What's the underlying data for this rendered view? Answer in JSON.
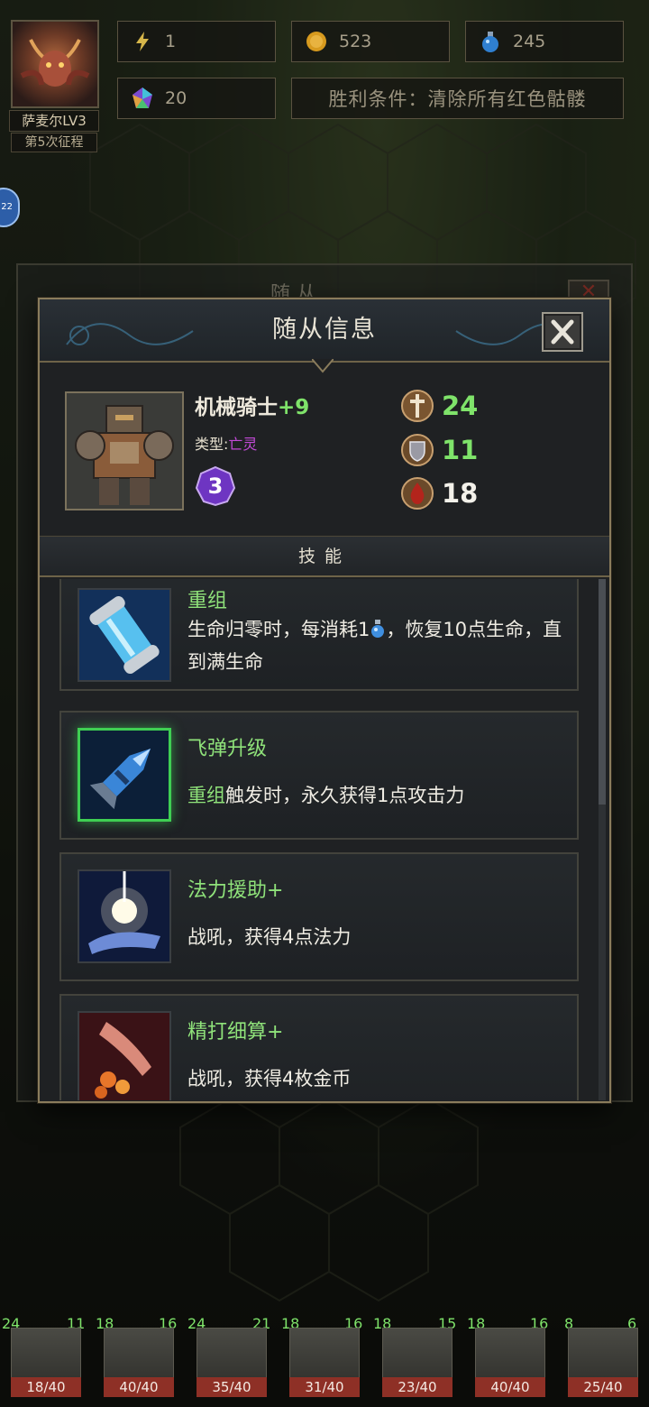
{
  "hud": {
    "hero_name": "萨麦尔LV3",
    "expedition": "第5次征程",
    "energy": "1",
    "gold": "523",
    "potion": "245",
    "gems": "20",
    "win_condition": "胜利条件：清除所有红色骷髅",
    "side_badge": "22"
  },
  "background_panel": {
    "title": "随 从",
    "close_icon": "close-icon"
  },
  "dialog": {
    "title": "随从信息",
    "close_icon": "close-icon"
  },
  "unit": {
    "name": "机械骑士",
    "upgrade": "+9",
    "type_label": "类型:",
    "type_value": "亡灵",
    "level": "3",
    "attack": "24",
    "armor": "11",
    "hp": "18",
    "portrait_icon": "mech-knight-portrait"
  },
  "skills_header": "技能",
  "skills": [
    {
      "name": "重组",
      "desc_parts": [
        "生命归零时，每消耗1",
        "，恢复10点生命，直到满生命"
      ],
      "inline_icon": "potion-icon",
      "icon": "battery-capsule-icon",
      "active": false
    },
    {
      "name": "飞弹升级",
      "desc_highlight": "重组",
      "desc_rest": "触发时，永久获得1点攻击力",
      "icon": "missile-icon",
      "active": true
    },
    {
      "name": "法力援助+",
      "desc": "战吼，获得4点法力",
      "icon": "mana-hand-icon",
      "active": false
    },
    {
      "name": "精打细算+",
      "desc": "战吼，获得4枚金币",
      "icon": "coin-hand-icon",
      "active": false
    }
  ],
  "team": [
    {
      "atk": "24",
      "def": "11",
      "hp": "18/40"
    },
    {
      "atk": "18",
      "def": "16",
      "hp": "40/40"
    },
    {
      "atk": "24",
      "def": "21",
      "hp": "35/40"
    },
    {
      "atk": "18",
      "def": "16",
      "hp": "31/40"
    },
    {
      "atk": "18",
      "def": "15",
      "hp": "23/40"
    },
    {
      "atk": "18",
      "def": "16",
      "hp": "40/40"
    },
    {
      "atk": "8",
      "def": "6",
      "hp": "25/40"
    }
  ],
  "colors": {
    "stat_green": "#7fe36a",
    "type_purple": "#c44ad8",
    "skill_name_green": "#8fe27a",
    "active_border": "#3fcf53",
    "frame_gold": "#8a7c5c",
    "hp_bar_red": "#8e3026"
  }
}
